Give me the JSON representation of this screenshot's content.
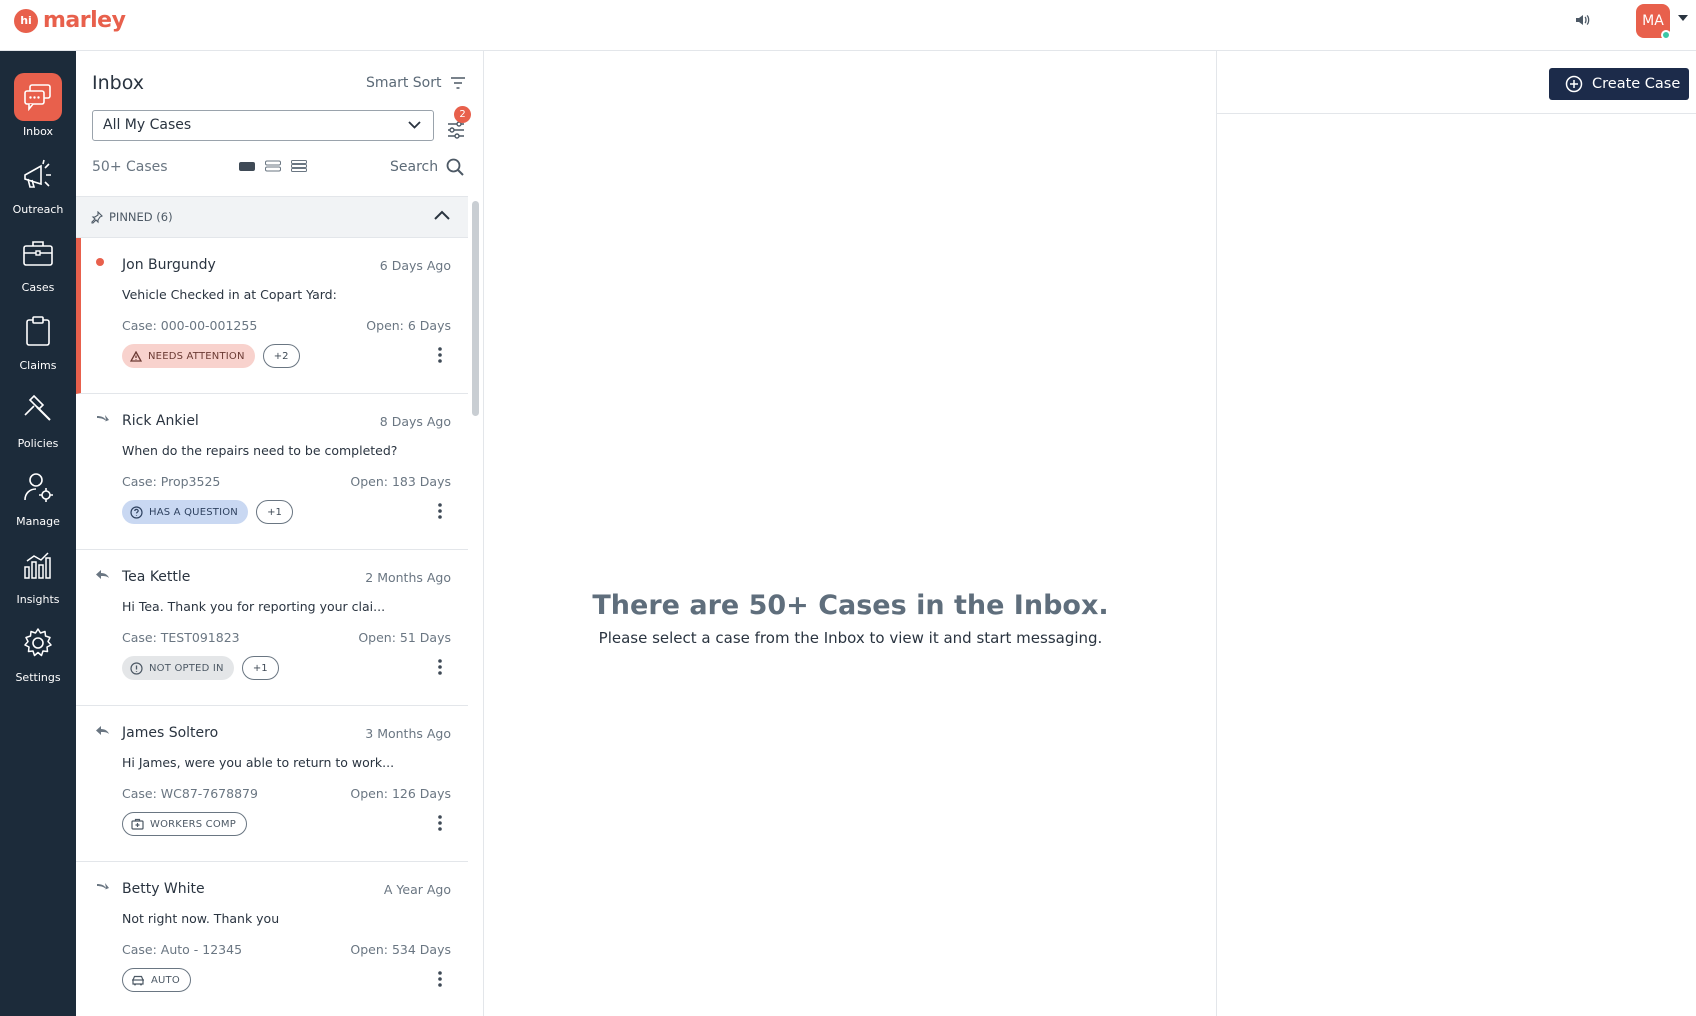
{
  "app": {
    "logo_badge": "hi",
    "logo_text": "marley",
    "user_initials": "MA"
  },
  "sidebar": {
    "items": [
      {
        "id": "inbox",
        "label": "Inbox",
        "icon": "chat-bubbles-icon",
        "active": true
      },
      {
        "id": "outreach",
        "label": "Outreach",
        "icon": "megaphone-icon",
        "active": false
      },
      {
        "id": "cases",
        "label": "Cases",
        "icon": "briefcase-icon",
        "active": false
      },
      {
        "id": "claims",
        "label": "Claims",
        "icon": "clipboard-icon",
        "active": false
      },
      {
        "id": "policies",
        "label": "Policies",
        "icon": "gavel-icon",
        "active": false
      },
      {
        "id": "manage",
        "label": "Manage",
        "icon": "user-gear-icon",
        "active": false
      },
      {
        "id": "insights",
        "label": "Insights",
        "icon": "bar-chart-icon",
        "active": false
      },
      {
        "id": "settings",
        "label": "Settings",
        "icon": "gear-icon",
        "active": false
      }
    ]
  },
  "inbox": {
    "title": "Inbox",
    "sort_label": "Smart Sort",
    "filter_value": "All My Cases",
    "filter_badge": "2",
    "count_label": "50+ Cases",
    "search_label": "Search",
    "pinned_label": "PINNED (6)",
    "cases": [
      {
        "name": "Jon Burgundy",
        "time": "6 Days Ago",
        "preview": "Vehicle Checked in at Copart Yard:",
        "case_number": "Case: 000-00-001255",
        "open": "Open: 6 Days",
        "tag": "NEEDS ATTENTION",
        "more": "+2",
        "indicator": "unread-dot-icon"
      },
      {
        "name": "Rick Ankiel",
        "time": "8 Days Ago",
        "preview": "When do the repairs need to be completed?",
        "case_number": "Case: Prop3525",
        "open": "Open: 183 Days",
        "tag": "HAS A QUESTION",
        "more": "+1",
        "indicator": "forward-arrow-icon"
      },
      {
        "name": "Tea Kettle",
        "time": "2 Months Ago",
        "preview": "Hi Tea. Thank you for reporting your clai...",
        "case_number": "Case: TEST091823",
        "open": "Open: 51 Days",
        "tag": "NOT OPTED IN",
        "more": "+1",
        "indicator": "reply-arrow-icon"
      },
      {
        "name": "James Soltero",
        "time": "3 Months Ago",
        "preview": "Hi James, were you able to return to work...",
        "case_number": "Case: WC87-7678879",
        "open": "Open: 126 Days",
        "tag": "WORKERS COMP",
        "more": "",
        "indicator": "reply-arrow-icon"
      },
      {
        "name": "Betty White",
        "time": "A Year Ago",
        "preview": "Not right now. Thank you",
        "case_number": "Case: Auto - 12345",
        "open": "Open: 534 Days",
        "tag": "AUTO",
        "more": "",
        "indicator": "forward-arrow-icon"
      }
    ]
  },
  "empty_state": {
    "title": "There are 50+ Cases in the Inbox.",
    "subtitle": "Please select a case from the Inbox to view it and start messaging."
  },
  "right_panel": {
    "create_label": "Create Case"
  },
  "colors": {
    "accent": "#e8604c",
    "sidebar": "#1c2b3a",
    "button": "#1c2b4a",
    "online": "#3cc8a6"
  }
}
